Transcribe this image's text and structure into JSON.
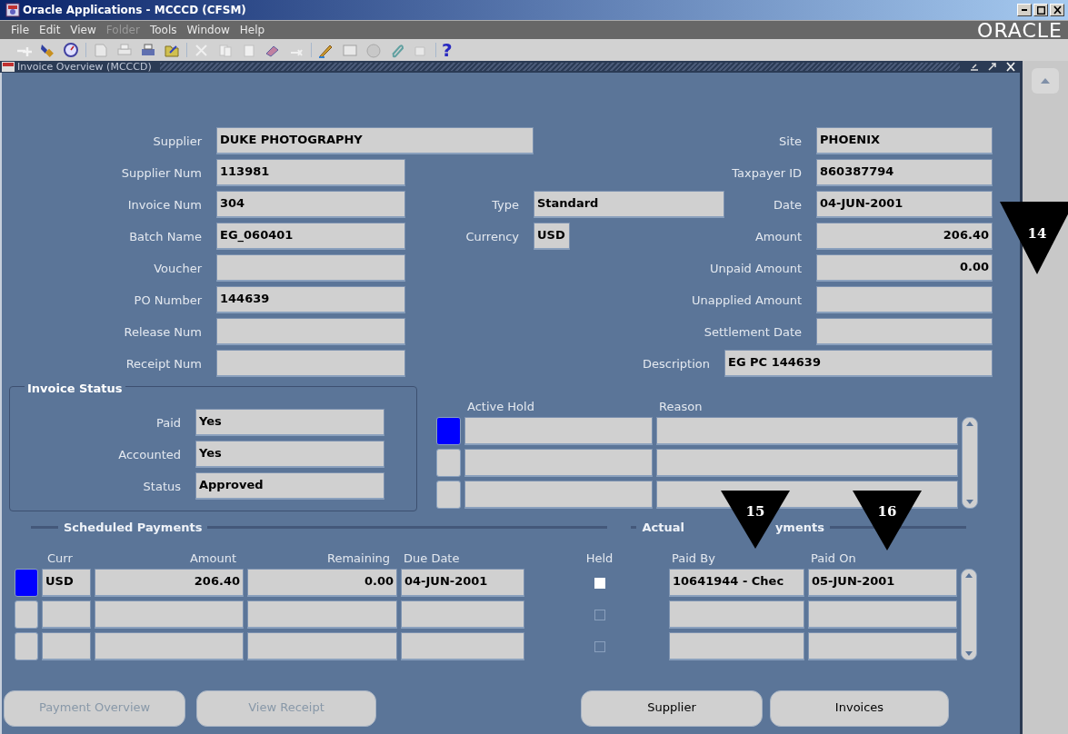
{
  "window": {
    "title": "Oracle Applications - MCCCD (CFSM)"
  },
  "menu": [
    {
      "label": "File",
      "disabled": false
    },
    {
      "label": "Edit",
      "disabled": false
    },
    {
      "label": "View",
      "disabled": false
    },
    {
      "label": "Folder",
      "disabled": true
    },
    {
      "label": "Tools",
      "disabled": false
    },
    {
      "label": "Window",
      "disabled": false
    },
    {
      "label": "Help",
      "disabled": false
    }
  ],
  "logo": "ORACLE",
  "toolbar": {
    "help": "?"
  },
  "form": {
    "title": "Invoice Overview (MCCCD)",
    "header_rows": [
      {
        "left": {
          "label": "Supplier",
          "value": "DUKE PHOTOGRAPHY",
          "kind": "wide"
        },
        "right": {
          "label": "Site",
          "value": "PHOENIX",
          "kind": "text"
        }
      },
      {
        "left": {
          "label": "Supplier Num",
          "value": "113981",
          "kind": "text"
        },
        "right": {
          "label": "Taxpayer ID",
          "value": "860387794",
          "kind": "text"
        }
      },
      {
        "left": {
          "label": "Invoice Num",
          "value": "304",
          "kind": "text"
        },
        "middle": {
          "label": "Type",
          "value": "Standard",
          "kind": "text"
        },
        "right": {
          "label": "Date",
          "value": "04-JUN-2001",
          "kind": "text"
        }
      },
      {
        "left": {
          "label": "Batch Name",
          "value": "EG_060401",
          "kind": "text"
        },
        "middle": {
          "label": "Currency",
          "value": "USD",
          "kind": "narrow"
        },
        "right": {
          "label": "Amount",
          "value": "206.40",
          "kind": "amount"
        }
      },
      {
        "left": {
          "label": "Voucher",
          "kind": "text"
        },
        "right": {
          "label": "Unpaid Amount",
          "value": "0.00",
          "kind": "amount"
        }
      },
      {
        "left": {
          "label": "PO Number",
          "value": "144639",
          "kind": "text"
        },
        "right": {
          "label": "Unapplied Amount",
          "kind": "amount"
        }
      },
      {
        "left": {
          "label": "Release Num",
          "kind": "text"
        },
        "right": {
          "label": "Settlement Date",
          "kind": "text"
        }
      },
      {
        "left": {
          "label": "Receipt Num",
          "kind": "text"
        },
        "middle": {
          "label": "Description",
          "value": "EG PC 144639",
          "kind": "wide"
        }
      }
    ]
  },
  "invoice_status": {
    "title": "Invoice Status",
    "fields": [
      {
        "label": "Paid",
        "value": "Yes"
      },
      {
        "label": "Accounted",
        "value": "Yes"
      },
      {
        "label": "Status",
        "value": "Approved"
      }
    ]
  },
  "holds": {
    "columns": [
      "Active Hold",
      "Reason"
    ],
    "rows": [
      {
        "selected": true
      },
      {
        "selected": false
      },
      {
        "selected": false
      }
    ]
  },
  "scheduled_payments": {
    "title": "Scheduled Payments",
    "columns": [
      "Curr",
      "Amount",
      "Remaining",
      "Due Date",
      "Held"
    ],
    "rows": [
      {
        "selected": true,
        "curr": "USD",
        "amount": "206.40",
        "remaining": "0.00",
        "due_date": "04-JUN-2001",
        "held": {
          "checked": false,
          "disabled": false
        }
      },
      {
        "selected": false,
        "held": {
          "checked": false,
          "disabled": true
        }
      },
      {
        "selected": false,
        "held": {
          "checked": false,
          "disabled": true
        }
      }
    ]
  },
  "actual_payments": {
    "title_parts": [
      "Actual",
      "yments"
    ],
    "columns": [
      "Paid By",
      "Paid On"
    ],
    "rows": [
      {
        "paid_by": "10641944 - Chec",
        "paid_on": "05-JUN-2001"
      },
      {},
      {}
    ]
  },
  "buttons": [
    {
      "label": "Payment Overview",
      "disabled": true
    },
    {
      "label": "View Receipt",
      "disabled": true
    },
    {
      "label": "Supplier",
      "disabled": false
    },
    {
      "label": "Invoices",
      "disabled": false
    }
  ],
  "callouts": [
    {
      "number": "14",
      "kind": "amount"
    },
    {
      "number": "15",
      "kind": "paid-by"
    },
    {
      "number": "16",
      "kind": "paid-on"
    }
  ]
}
